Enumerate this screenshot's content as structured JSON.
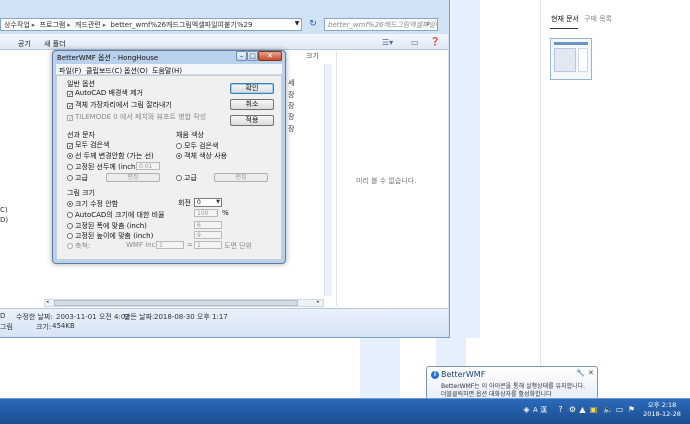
{
  "explorer": {
    "breadcrumb": [
      "상수작업",
      "프로그램",
      "캐드관련",
      "better_wmf%26캐드그림엑셀파일여붙기%29"
    ],
    "search_placeholder": "better_wmf%26캐드그림엑셀파일여붙기...",
    "toolbar": {
      "organize": "공기",
      "new_folder": "새 폴더"
    },
    "column_size": "크기",
    "side_frags": [
      "세",
      "장",
      "장",
      "장",
      "장"
    ],
    "preview_text": "미리 볼 수 없습니다.",
    "left_frags": [
      "C)",
      "D)"
    ],
    "status": {
      "modified_label": "수정한 날짜:",
      "modified_value": "2003-11-01 오전 4:02",
      "created_label": "만든 날짜:",
      "created_value": "2018-08-30 오후 1:17",
      "size_label": "크기:",
      "size_value": "454KB",
      "name_frag": "D",
      "type_frag": "그림"
    }
  },
  "doc_panel": {
    "tab_current": "현재 문서",
    "tab_purchase": "구매 목록"
  },
  "dialog": {
    "title": "BetterWMF 옵션 - HongHouse",
    "menu": [
      "파일(F)",
      "클립보드(C)",
      "옵션(O)",
      "도움말(H)"
    ],
    "general": {
      "title": "일반 옵션",
      "remove_bg": "AutoCAD 배경색 제거",
      "crop": "객체 가장자리에서 그림 잘라내기",
      "tilemode": "TILEMODE 0 에서 페치와 뷰포트 병합 작성"
    },
    "buttons": {
      "ok": "확인",
      "cancel": "취소",
      "apply": "적용"
    },
    "lines": {
      "title": "선과 문자",
      "all_black": "모두 검은색",
      "keep_width": "선 두께 변경안함 (가는 선)",
      "fixed_width": "고정된 선두께 (inch)",
      "fixed_width_value": "0.01",
      "advanced": "고급",
      "edit": "편집"
    },
    "fill": {
      "title": "채움 색상",
      "all_black": "모두 검은색",
      "object_color": "객체 색상 사용",
      "advanced": "고급",
      "edit": "편집"
    },
    "size": {
      "title": "그림 크기",
      "keep": "크기 수정 안함",
      "ratio": "AutoCAD의 크기에 대한 비율",
      "ratio_value": "100",
      "ratio_unit": "%",
      "fit_width": "고정된 폭에 맞춤 (inch)",
      "fit_width_value": "6",
      "fit_height": "고정된 높이에 맞춤 (inch)",
      "fit_height_value": "9",
      "scale": "축척:",
      "wmf_inch": "WMF inch",
      "scale_value_1": "1",
      "equals": "=",
      "scale_value_2": "1",
      "drawing_unit": "도면 단위",
      "rotate_label": "회전",
      "rotate_value": "0"
    }
  },
  "balloon": {
    "title": "BetterWMF",
    "line1": "BetterWMF는 이 아이콘을 통해 실행상태를 유지합니다.",
    "line2": "더블클릭하면 옵션 대화상자를 활성화합니다"
  },
  "taskbar": {
    "ime": "A 漢",
    "time": "오후 2:18",
    "date": "2018-12-28"
  }
}
